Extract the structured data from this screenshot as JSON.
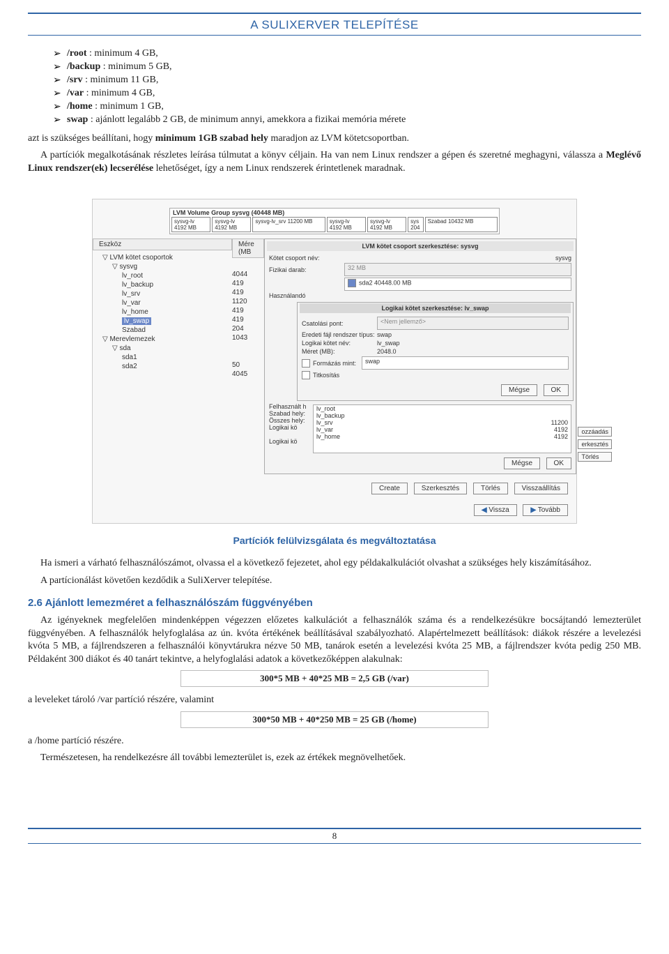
{
  "header": {
    "title": "A SULIXERVER TELEPÍTÉSE"
  },
  "bullets": [
    {
      "dir": "/root",
      "text": " : minimum 4 GB,"
    },
    {
      "dir": "/backup",
      "text": " : minimum 5 GB,"
    },
    {
      "dir": "/srv",
      "text": " : minimum 11 GB,"
    },
    {
      "dir": "/var",
      "text": " : minimum 4 GB,"
    },
    {
      "dir": "/home",
      "text": " : minimum 1 GB,"
    },
    {
      "dir": "swap",
      "text": " : ajánlott legalább 2 GB, de minimum annyi, amekkora a fizikai memória mérete"
    }
  ],
  "para1_pre": "azt is szükséges beállítani, hogy ",
  "para1_bold": "minimum 1GB szabad hely",
  "para1_post": " maradjon az LVM kötetcsoportban.",
  "para2_a": "A partíciók megalkotásának részletes leírása túlmutat a könyv céljain. Ha van nem Linux rendszer a gépen és szeretné meghagyni, válassza a ",
  "para2_bold": "Meglévő Linux rendszer(ek) lecserélése",
  "para2_b": " lehetőséget, így a nem Linux rendszerek érintetlenek maradnak.",
  "shot": {
    "vg_title": "LVM Volume Group sysvg (40448 MB)",
    "vg_cells_a": [
      "sysvg-lv\n4192 MB",
      "sysvg-lv\n4192 MB",
      "sysvg-lv_srv\n11200 MB"
    ],
    "vg_cells_b": [
      "sysvg-lv\n4192 MB",
      "sysvg-lv\n4192 MB",
      "sys\n204",
      "Szabad\n10432 MB"
    ],
    "tree_head_l": "Eszköz",
    "tree_head_r": "Mére (MB",
    "tree": [
      {
        "t": "▽ LVM kötet csoportok",
        "cls": "",
        "s": ""
      },
      {
        "t": "▽ sysvg",
        "cls": "in1",
        "s": "4044"
      },
      {
        "t": "lv_root",
        "cls": "in2",
        "s": "419"
      },
      {
        "t": "lv_backup",
        "cls": "in2",
        "s": "419"
      },
      {
        "t": "lv_srv",
        "cls": "in2",
        "s": "1120"
      },
      {
        "t": "lv_var",
        "cls": "in2",
        "s": "419"
      },
      {
        "t": "lv_home",
        "cls": "in2",
        "s": "419"
      },
      {
        "t": "lv_swap",
        "cls": "in2 sel",
        "s": "204"
      },
      {
        "t": "Szabad",
        "cls": "in2",
        "s": "1043"
      },
      {
        "t": "▽ Merevlemezek",
        "cls": "",
        "s": ""
      },
      {
        "t": "▽ sda",
        "cls": "in1",
        "s": ""
      },
      {
        "t": "sda1",
        "cls": "in2",
        "s": "50"
      },
      {
        "t": "sda2",
        "cls": "in2",
        "s": "4045"
      }
    ],
    "panel1_title": "LVM kötet csoport szerkesztése: sysvg",
    "p1_group_label": "Kötet csoport név:",
    "p1_group_value": "sysvg",
    "p1_phys_label": "Fizikai darab:",
    "p1_phys_value": "32 MB",
    "p1_sda2": "sda2   40448.00 MB",
    "p1_use_label": "Használandó",
    "p1_freeh": "Felhasznált h",
    "p1_free": "Szabad hely:",
    "p1_total": "Összes hely:",
    "p1_lv_label": "Logikai kö",
    "p1_lv_label2": "Logikai kö",
    "lv_list": [
      {
        "n": "lv_root",
        "v": ""
      },
      {
        "n": "lv_backup",
        "v": ""
      },
      {
        "n": "lv_srv",
        "v": "11200"
      },
      {
        "n": "lv_var",
        "v": "4192"
      },
      {
        "n": "lv_home",
        "v": "4192"
      }
    ],
    "panel2_title": "Logikai kötet szerkesztése: lv_swap",
    "p2_mount_l": "Csatolási pont:",
    "p2_mount_v": "<Nem jellemző>",
    "p2_origfs_l": "Eredeti fájl rendszer típus:",
    "p2_origfs_v": "swap",
    "p2_lvname_l": "Logikai kötet név:",
    "p2_lvname_v": "lv_swap",
    "p2_size_l": "Méret (MB):",
    "p2_size_v": "2048.0",
    "p2_format_l": "Formázás mint:",
    "p2_format_v": "swap",
    "p2_encrypt": "Titkosítás",
    "btn_megse": "Mégse",
    "btn_ok": "OK",
    "rbtn_add": "ozzáadás",
    "rbtn_edit": "erkesztés",
    "rbtn_del": "Törlés",
    "bottom": [
      "Create",
      "Szerkesztés",
      "Törlés",
      "Visszaállítás"
    ],
    "nav_back": "Vissza",
    "nav_fwd": "Tovább"
  },
  "caption": "Partíciók felülvizsgálata és megváltoztatása",
  "para3": "Ha ismeri a várható felhasználószámot, olvassa el a következő fejezetet, ahol egy példakalkulációt olvashat a szükséges hely kiszámításához.",
  "para4": "A partícionálást követően kezdődik a SuliXerver telepítése.",
  "section": "2.6 Ajánlott lemezméret a felhasználószám függvényében",
  "para5": "Az igényeknek megfelelően mindenképpen végezzen előzetes kalkulációt a felhasználók száma és a rendelkezésükre bocsájtandó lemezterület függvényében. A felhasználók helyfoglalása az ún. kvóta értékének beállításával szabályozható. Alapértelmezett beállítások: diákok részére a levelezési kvóta 5 MB, a fájlrendszeren a felhasználói könyvtárukra nézve 50 MB, tanárok esetén a levelezési kvóta 25 MB, a fájlrendszer kvóta pedig 250 MB. Példaként 300 diákot és 40 tanárt tekintve, a helyfoglalási adatok a következőképpen alakulnak:",
  "formula1": "300*5 MB + 40*25 MB = 2,5 GB (/var)",
  "para6": "a leveleket tároló /var partíció részére, valamint",
  "formula2": "300*50 MB + 40*250 MB = 25 GB (/home)",
  "para7": "a /home partíció részére.",
  "para8": "Természetesen, ha rendelkezésre áll további lemezterület is, ezek az értékek megnövelhetőek.",
  "page_no": "8"
}
